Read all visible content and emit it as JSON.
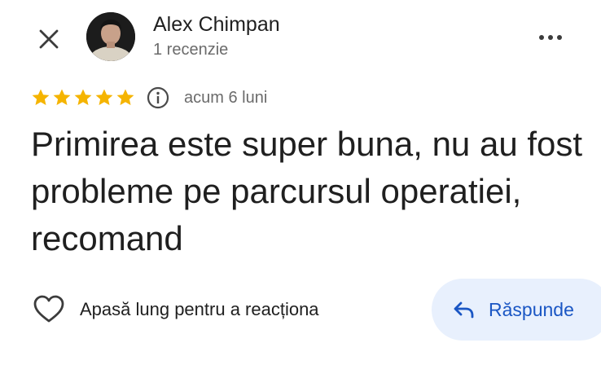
{
  "header": {
    "close_icon": "close-icon",
    "more_icon": "more-horizontal-icon"
  },
  "author": {
    "name": "Alex Chimpan",
    "review_count": "1 recenzie"
  },
  "review": {
    "rating": 5,
    "rating_max": 5,
    "star_color": "#F5B400",
    "info_icon": "info-icon",
    "date": "acum 6 luni",
    "text": "Primirea este super buna, nu au fost probleme pe parcursul operatiei, recomand"
  },
  "actions": {
    "react_icon": "heart-outline-icon",
    "react_label": "Apasă lung pentru a reacționa",
    "reply_icon": "reply-arrow-icon",
    "reply_label": "Răspunde",
    "reply_color": "#1A56C4"
  }
}
